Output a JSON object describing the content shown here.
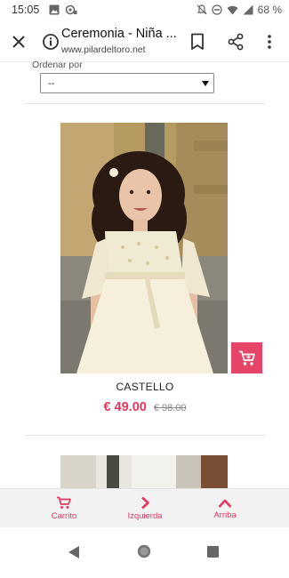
{
  "status_bar": {
    "time": "15:05",
    "battery": "68 %"
  },
  "tab_bar": {
    "title": "Ceremonia - Niña ...",
    "url": "www.pilardeltoro.net"
  },
  "sort": {
    "label": "Ordenar por",
    "selected": "--"
  },
  "product": {
    "name": "CASTELLO",
    "price": "€ 49.00",
    "old_price": "€ 98.00"
  },
  "bottom_nav": {
    "cart_label": "Carrito",
    "left_label": "Izquierda",
    "top_label": "Arriba"
  },
  "colors": {
    "accent": "#e0385f",
    "cart_button": "#e6456a"
  }
}
